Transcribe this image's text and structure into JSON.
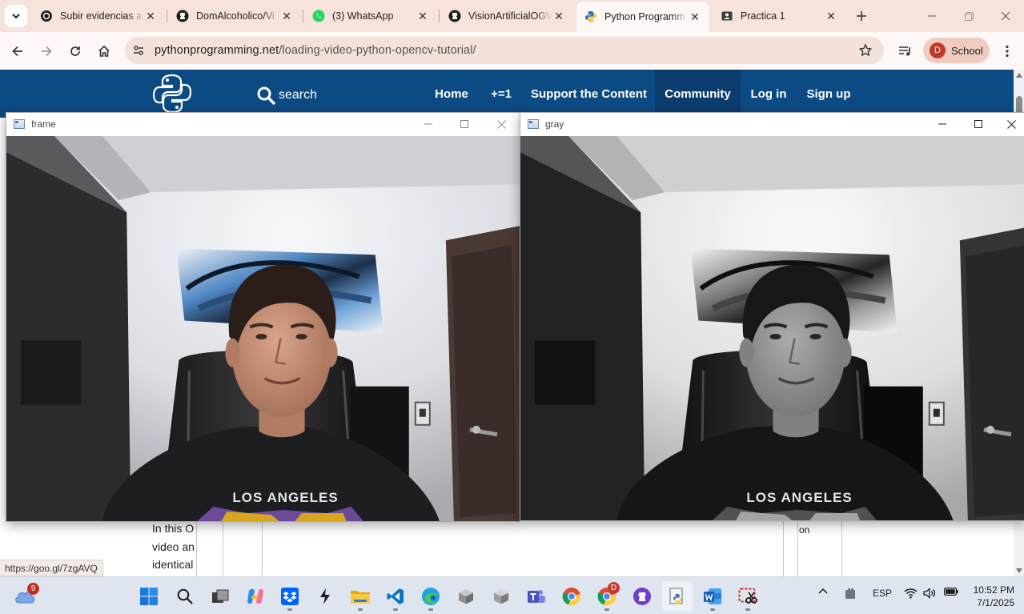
{
  "browser": {
    "tabs": [
      {
        "title": "Subir evidencias a",
        "icon": "openai-icon"
      },
      {
        "title": "DomAlcoholico/Vi",
        "icon": "github-icon"
      },
      {
        "title": "(3) WhatsApp",
        "icon": "whatsapp-icon"
      },
      {
        "title": "VisionArtificialOGV",
        "icon": "github-icon"
      },
      {
        "title": "Python Programm",
        "icon": "python-icon",
        "active": true
      },
      {
        "title": "Practica 1",
        "icon": "classroom-icon"
      }
    ],
    "address": {
      "host": "pythonprogramming.net",
      "path": "/loading-video-python-opencv-tutorial/"
    },
    "profile": {
      "initial": "D",
      "label": "School"
    },
    "status_url": "https://goo.gl/7zgAVQ"
  },
  "site": {
    "search_label": "search",
    "nav": [
      "Home",
      "+=1",
      "Support the Content",
      "Community",
      "Log in",
      "Sign up"
    ],
    "body_lines": [
      "In this O",
      "video an",
      "identical"
    ],
    "side_fragment": "on"
  },
  "windows": {
    "frame": {
      "title": "frame"
    },
    "gray": {
      "title": "gray"
    },
    "shirt_text": "LOS ANGELES"
  },
  "taskbar": {
    "weather_badge": "9",
    "chrome_badge": "D",
    "language": "ESP",
    "time": "10:52 PM",
    "date": "7/1/2025"
  },
  "colors": {
    "site_nav": "#0c4a83",
    "tabstrip": "#f6e3dc",
    "taskbar": "#dfe5ee",
    "active_indicator": "#0067c0"
  }
}
